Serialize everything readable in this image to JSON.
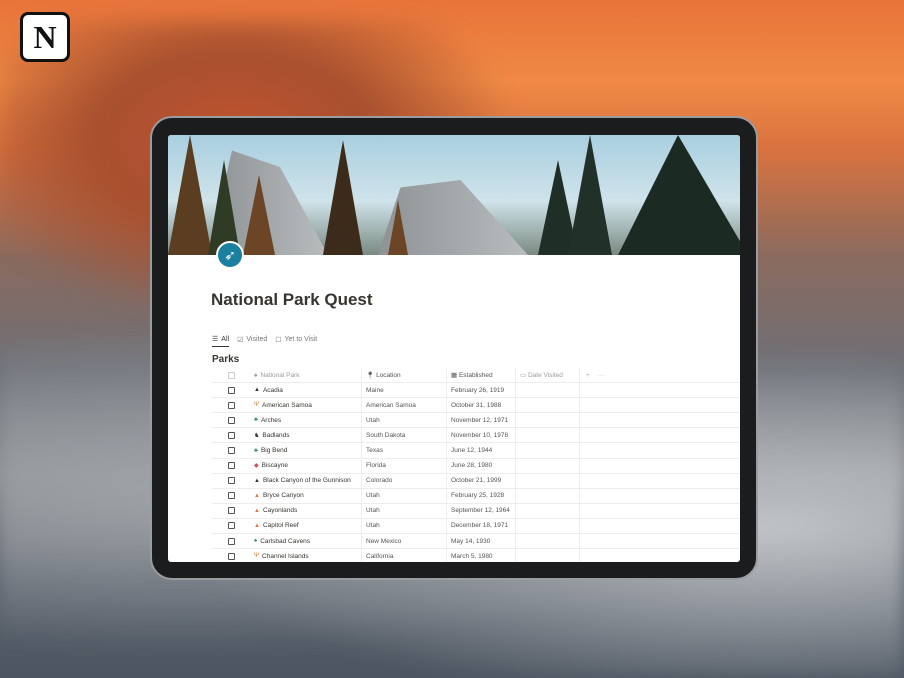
{
  "brand": {
    "logo_letter": "N"
  },
  "page": {
    "title": "National Park Quest",
    "icon": "compass-icon",
    "accent": "#1b7fa0"
  },
  "tabs": [
    {
      "label": "All",
      "icon": "list-icon"
    },
    {
      "label": "Visited",
      "icon": "checked-box-icon"
    },
    {
      "label": "Yet to Visit",
      "icon": "empty-box-icon"
    }
  ],
  "database": {
    "title": "Parks",
    "columns": [
      "National Park",
      "Location",
      "Established",
      "Date Visited"
    ],
    "add": "+",
    "more": "···",
    "rows": [
      {
        "name": "Acadia",
        "location": "Maine",
        "established": "February 26, 1919",
        "icon": "mountain-icon",
        "color": "#37352f"
      },
      {
        "name": "American Samoa",
        "location": "American Samoa",
        "established": "October 31, 1988",
        "icon": "palm-icon",
        "color": "#e07b39"
      },
      {
        "name": "Arches",
        "location": "Utah",
        "established": "November 12, 1971",
        "icon": "cactus-icon",
        "color": "#2e8b57"
      },
      {
        "name": "Badlands",
        "location": "South Dakota",
        "established": "November 10, 1978",
        "icon": "bison-icon",
        "color": "#37352f"
      },
      {
        "name": "Big Bend",
        "location": "Texas",
        "established": "June 12, 1944",
        "icon": "cactus-icon",
        "color": "#2e8b57"
      },
      {
        "name": "Biscayne",
        "location": "Florida",
        "established": "June 28, 1980",
        "icon": "fish-icon",
        "color": "#e0445a"
      },
      {
        "name": "Black Canyon of the Gunnison",
        "location": "Colorado",
        "established": "October 21, 1999",
        "icon": "mountain-icon",
        "color": "#37352f"
      },
      {
        "name": "Bryce Canyon",
        "location": "Utah",
        "established": "February 25, 1928",
        "icon": "mountain-icon",
        "color": "#e07b39"
      },
      {
        "name": "Cayonlands",
        "location": "Utah",
        "established": "September 12, 1964",
        "icon": "mountain-icon",
        "color": "#e07b39"
      },
      {
        "name": "Capitol Reef",
        "location": "Utah",
        "established": "December 18, 1971",
        "icon": "mountain-icon",
        "color": "#e07b39"
      },
      {
        "name": "Carlsbad Cavens",
        "location": "New Mexico",
        "established": "May 14, 1930",
        "icon": "tree-icon",
        "color": "#2e8b57"
      },
      {
        "name": "Channel Islands",
        "location": "California",
        "established": "March 5, 1980",
        "icon": "palm-icon",
        "color": "#e07b39"
      }
    ]
  }
}
